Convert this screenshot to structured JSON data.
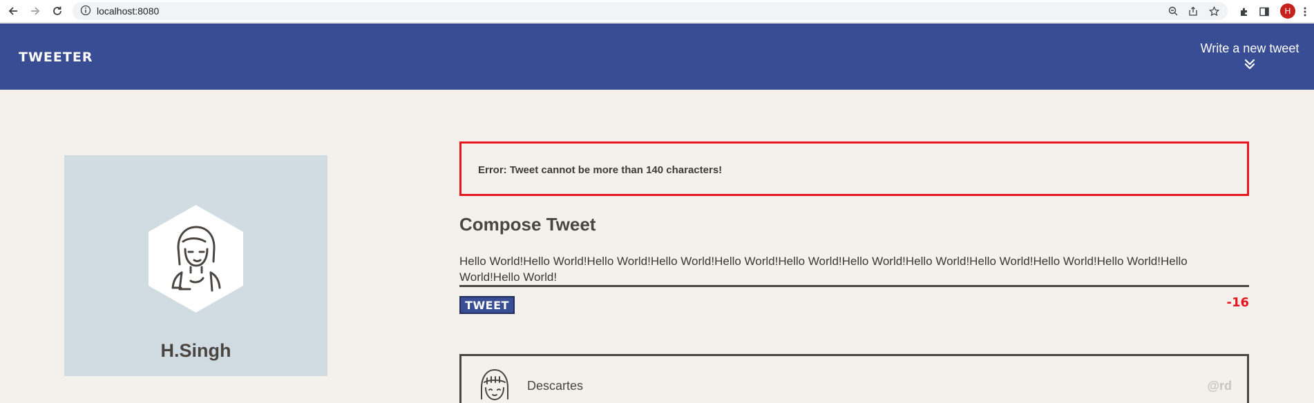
{
  "browser": {
    "url": "localhost:8080",
    "profile_initial": "H"
  },
  "header": {
    "brand": "TWEETER",
    "compose_toggle_label": "Write a new tweet"
  },
  "profile": {
    "name": "H.Singh"
  },
  "compose": {
    "error": "Error: Tweet cannot be more than 140 characters!",
    "title": "Compose Tweet",
    "text": "Hello World!Hello World!Hello World!Hello World!Hello World!Hello World!Hello World!Hello World!Hello World!Hello World!Hello World!Hello World!Hello World!",
    "submit_label": "TWEET",
    "counter": "-16"
  },
  "tweets": [
    {
      "author": "Descartes",
      "handle": "@rd"
    }
  ],
  "colors": {
    "header_bg": "#384d94",
    "page_bg": "#f4f1ec",
    "error": "#e8141e"
  }
}
